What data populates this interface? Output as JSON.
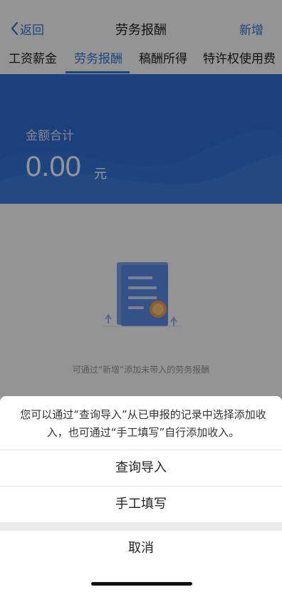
{
  "nav": {
    "back_label": "返回",
    "title": "劳务报酬",
    "add_label": "新增"
  },
  "tabs": [
    "工资薪金",
    "劳务报酬",
    "稿酬所得",
    "特许权使用费"
  ],
  "active_tab_index": 1,
  "summary": {
    "label": "金额合计",
    "amount": "0.00",
    "unit": "元"
  },
  "empty_state": {
    "text": "可通过“新增”添加未带入的劳务报酬"
  },
  "action_sheet": {
    "message": "您可以通过“查询导入”从已申报的记录中选择添加收入，也可通过“手工填写”自行添加收入。",
    "options": [
      "查询导入",
      "手工填写"
    ],
    "cancel_label": "取消"
  },
  "colors": {
    "accent": "#2f7bdc",
    "banner": "#2f6fd6"
  }
}
